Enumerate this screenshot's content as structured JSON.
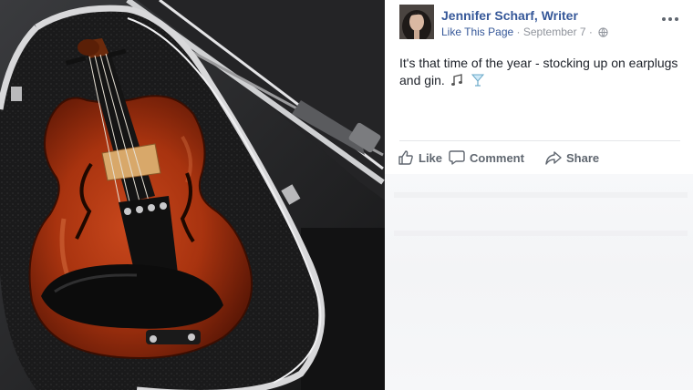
{
  "post": {
    "author": "Jennifer Scharf, Writer",
    "like_page": "Like This Page",
    "separator": "·",
    "date": "September 7",
    "text": "It's that time of the year - stocking up on earplugs and gin."
  },
  "actions": {
    "like": "Like",
    "comment": "Comment",
    "share": "Share"
  },
  "icons": {
    "privacy": "globe-icon",
    "menu": "more-options-icon",
    "emoji_1": "musical-notes-icon",
    "emoji_2": "cocktail-glass-icon",
    "like": "thumbs-up-icon",
    "comment": "speech-bubble-icon",
    "share": "share-arrow-icon"
  },
  "colors": {
    "link": "#365899",
    "meta": "#90949c",
    "action": "#606770",
    "violin": "#a8330f",
    "case_trim": "#d8d8da"
  }
}
